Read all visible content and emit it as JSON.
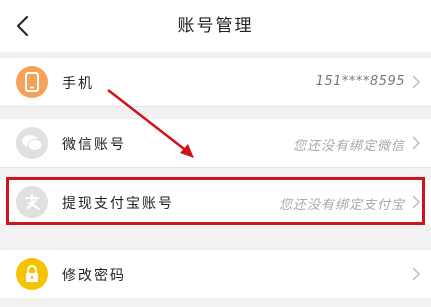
{
  "header": {
    "title": "账号管理"
  },
  "rows": [
    {
      "label": "手机",
      "value": "151****8595",
      "icon": "phone-icon",
      "icon_color": "#f5a25a"
    },
    {
      "label": "微信账号",
      "value": "您还没有绑定微信",
      "icon": "wechat-icon",
      "icon_color": "#e0e0e0"
    },
    {
      "label": "提现支付宝账号",
      "value": "您还没有绑定支付宝",
      "icon": "alipay-icon",
      "icon_color": "#e0e0e0"
    },
    {
      "label": "修改密码",
      "value": "",
      "icon": "lock-icon",
      "icon_color": "#f5c400"
    }
  ],
  "colors": {
    "highlight": "#d1121b",
    "background": "#f2f2f2"
  }
}
